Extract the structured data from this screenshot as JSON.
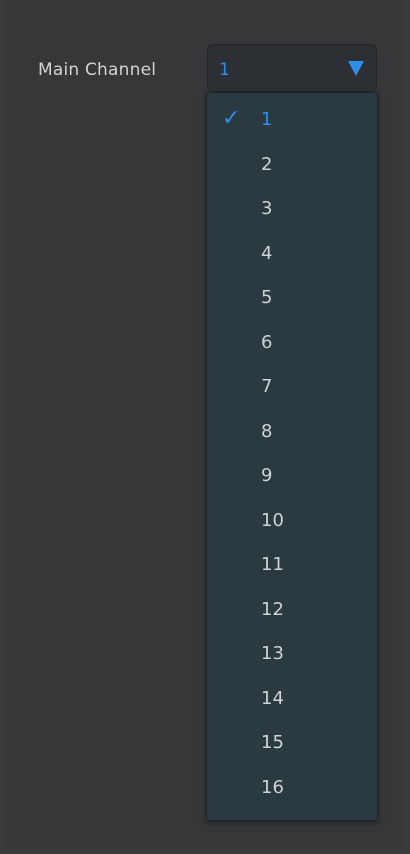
{
  "main_channel": {
    "label": "Main Channel",
    "selected_value": "1",
    "accent_color": "#2d8fe8",
    "options": [
      {
        "label": "1",
        "selected": true
      },
      {
        "label": "2",
        "selected": false
      },
      {
        "label": "3",
        "selected": false
      },
      {
        "label": "4",
        "selected": false
      },
      {
        "label": "5",
        "selected": false
      },
      {
        "label": "6",
        "selected": false
      },
      {
        "label": "7",
        "selected": false
      },
      {
        "label": "8",
        "selected": false
      },
      {
        "label": "9",
        "selected": false
      },
      {
        "label": "10",
        "selected": false
      },
      {
        "label": "11",
        "selected": false
      },
      {
        "label": "12",
        "selected": false
      },
      {
        "label": "13",
        "selected": false
      },
      {
        "label": "14",
        "selected": false
      },
      {
        "label": "15",
        "selected": false
      },
      {
        "label": "16",
        "selected": false
      }
    ],
    "check_icon": "checkmark-icon",
    "arrow_icon": "triangle-down-icon"
  }
}
